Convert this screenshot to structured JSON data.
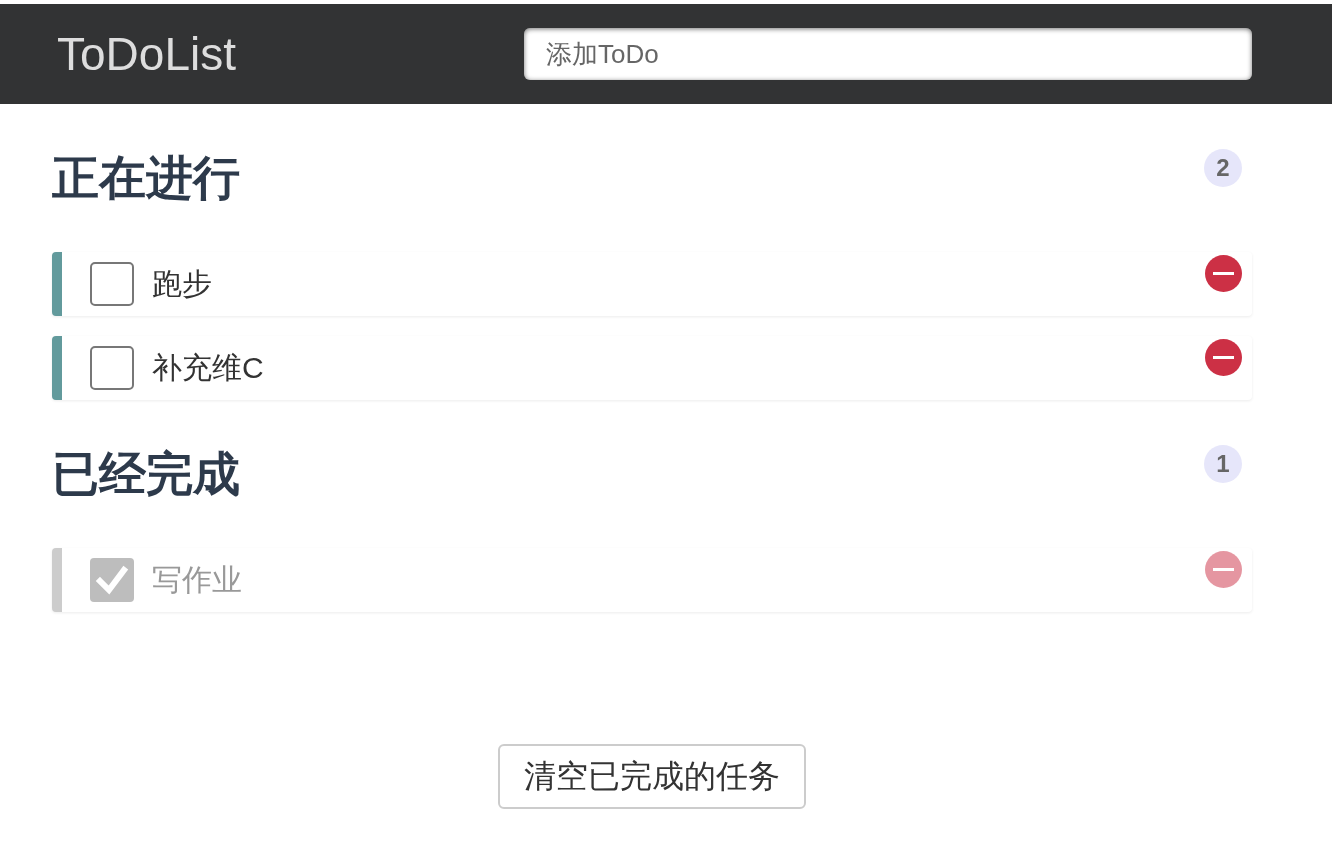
{
  "header": {
    "title": "ToDoList",
    "new_todo_field": {
      "placeholder": "添加ToDo"
    }
  },
  "sections": [
    {
      "title": "正在进行",
      "count": "2",
      "items": [
        {
          "text": "跑步",
          "checked": false
        },
        {
          "text": "补充维C",
          "checked": false
        }
      ]
    },
    {
      "title": "已经完成",
      "count": "1",
      "items": [
        {
          "text": "写作业",
          "checked": true
        }
      ]
    }
  ],
  "clear_button": {
    "label": "清空已完成的任务"
  }
}
